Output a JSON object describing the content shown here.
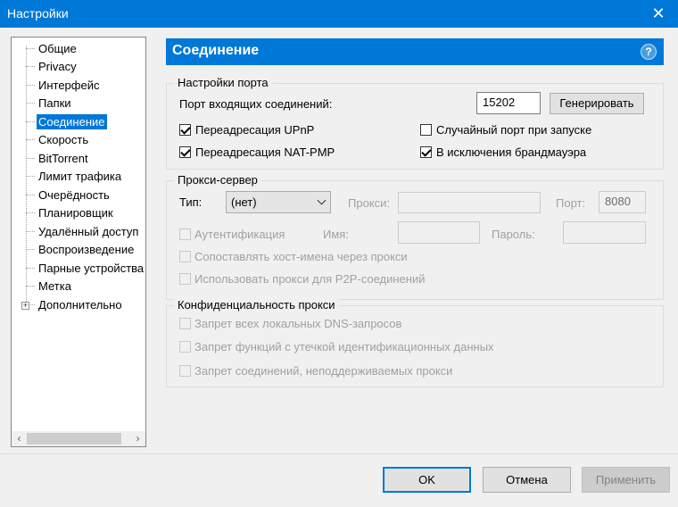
{
  "window": {
    "title": "Настройки",
    "close_glyph": "✕"
  },
  "tree": {
    "items": [
      {
        "label": "Общие"
      },
      {
        "label": "Privacy"
      },
      {
        "label": "Интерфейс"
      },
      {
        "label": "Папки"
      },
      {
        "label": "Соединение"
      },
      {
        "label": "Скорость"
      },
      {
        "label": "BitTorrent"
      },
      {
        "label": "Лимит трафика"
      },
      {
        "label": "Очерёдность"
      },
      {
        "label": "Планировщик"
      },
      {
        "label": "Удалённый доступ"
      },
      {
        "label": "Воспроизведение"
      },
      {
        "label": "Парные устройства"
      },
      {
        "label": "Метка"
      },
      {
        "label": "Дополнительно"
      }
    ],
    "selected": "Соединение",
    "expander_glyph": "+",
    "scroll_left": "‹",
    "scroll_right": "›"
  },
  "header": {
    "title": "Соединение",
    "help": "?"
  },
  "port": {
    "group_title": "Настройки порта",
    "incoming_label": "Порт входящих соединений:",
    "incoming_value": "15202",
    "generate_button": "Генерировать",
    "upnp": {
      "label": "Переадресация UPnP",
      "checked": true
    },
    "natpmp": {
      "label": "Переадресация NAT-PMP",
      "checked": true
    },
    "random": {
      "label": "Случайный порт при запуске",
      "checked": false
    },
    "firewall": {
      "label": "В исключения брандмауэра",
      "checked": true
    }
  },
  "proxy": {
    "group_title": "Прокси-сервер",
    "type_label": "Тип:",
    "type_value": "(нет)",
    "proxy_label": "Прокси:",
    "proxy_value": "",
    "port_label": "Порт:",
    "port_value": "8080",
    "auth_label": "Аутентификация",
    "name_label": "Имя:",
    "password_label": "Пароль:",
    "resolve_label": "Сопоставлять хост-имена через прокси",
    "p2p_label": "Использовать прокси для P2P-соединений"
  },
  "privacy": {
    "group_title": "Конфиденциальность прокси",
    "dns_label": "Запрет всех локальных DNS-запросов",
    "leak_label": "Запрет функций с утечкой идентификационных данных",
    "unsupported_label": "Запрет соединений, неподдерживаемых прокси"
  },
  "buttons": {
    "ok": "OK",
    "cancel": "Отмена",
    "apply": "Применить"
  },
  "colors": {
    "accent": "#0078d7"
  }
}
